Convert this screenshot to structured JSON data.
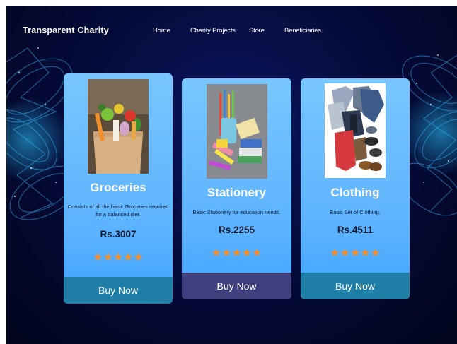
{
  "brand": {
    "name": "Transparent Charity"
  },
  "nav": {
    "items": [
      {
        "label": "Home"
      },
      {
        "label": "Charity Projects"
      },
      {
        "label": "Store"
      },
      {
        "label": "Beneficiaries"
      }
    ]
  },
  "cards": [
    {
      "title": "Groceries",
      "description": "Consists of all the basic Groceries required for a balanced diet.",
      "price": "Rs.3007",
      "rating": 5,
      "stars": "★★★★★",
      "buy_label": "Buy Now",
      "image": "groceries-bag-image",
      "button_color": "#1f7fa7"
    },
    {
      "title": "Stationery",
      "description": "Basic Stationery for education needs.",
      "price": "Rs.2255",
      "rating": 5,
      "stars": "★★★★★",
      "buy_label": "Buy Now",
      "image": "stationery-image",
      "button_color": "#3e3f7c"
    },
    {
      "title": "Clothing",
      "description": "Basic Set of Clothing.",
      "price": "Rs.4511",
      "rating": 5,
      "stars": "★★★★★",
      "buy_label": "Buy Now",
      "image": "clothing-image",
      "button_color": "#1f7fa7"
    }
  ],
  "colors": {
    "accent": "#5bb2ff",
    "star": "#f3912f",
    "background": "#050c3c"
  }
}
